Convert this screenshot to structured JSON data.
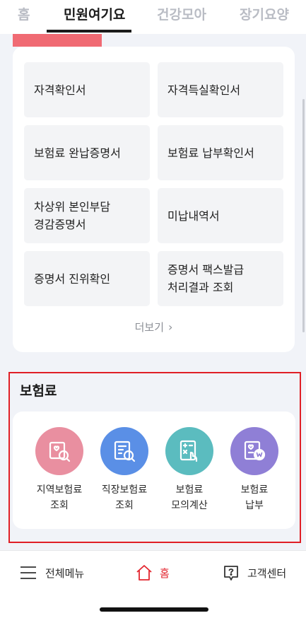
{
  "tabs": [
    {
      "label": "홈",
      "active": false
    },
    {
      "label": "민원여기요",
      "active": true
    },
    {
      "label": "건강모아",
      "active": false
    },
    {
      "label": "장기요양",
      "active": false
    }
  ],
  "certificates": [
    {
      "label": "자격확인서"
    },
    {
      "label": "자격득실확인서"
    },
    {
      "label": "보험료 완납증명서"
    },
    {
      "label": "보험료 납부확인서"
    },
    {
      "label": "차상위 본인부담\n경감증명서"
    },
    {
      "label": "미납내역서"
    },
    {
      "label": "증명서 진위확인"
    },
    {
      "label": "증명서 팩스발급\n처리결과 조회"
    }
  ],
  "more_link": "더보기",
  "insurance": {
    "title": "보험료",
    "items": [
      {
        "label": "지역보험료\n조회",
        "icon": "regional-insurance-search-icon",
        "color": "#e98fa0"
      },
      {
        "label": "직장보험료\n조회",
        "icon": "workplace-insurance-search-icon",
        "color": "#5a8fe6"
      },
      {
        "label": "보험료\n모의계산",
        "icon": "calculator-icon",
        "color": "#5bbcbf"
      },
      {
        "label": "보험료\n납부",
        "icon": "payment-icon",
        "color": "#8f7fd6"
      }
    ]
  },
  "bottom_nav": {
    "menu": "전체메뉴",
    "home": "홈",
    "help": "고객센터"
  },
  "colors": {
    "accent_red": "#e3262f",
    "highlight_border": "#e01f26",
    "card_bg": "#ffffff",
    "item_bg": "#f3f4f6"
  }
}
